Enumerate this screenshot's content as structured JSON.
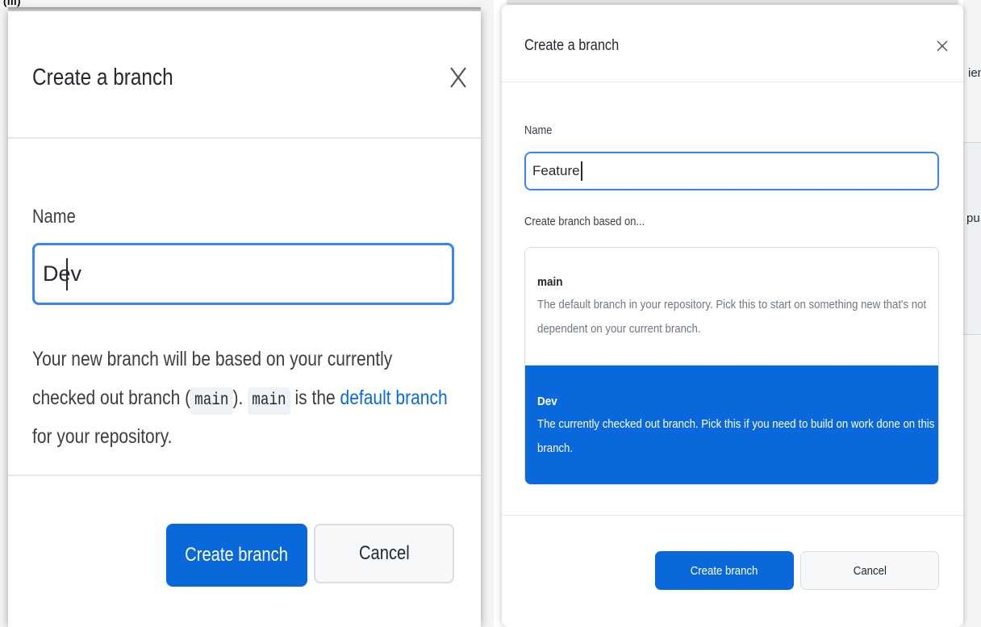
{
  "panel_label": "(iii)",
  "left_dialog": {
    "title": "Create a branch",
    "close_glyph": "X",
    "name_label": "Name",
    "name_value": "Dev",
    "description": {
      "part1": "Your new branch will be based on your currently checked out branch (",
      "code1": "main",
      "part2": ").",
      "code2": "main",
      "part3": " is the ",
      "link": "default branch",
      "part4": " for your repository."
    },
    "create_label": "Create branch",
    "cancel_label": "Cancel"
  },
  "right_dialog": {
    "title": "Create a branch",
    "close_glyph": "×",
    "name_label": "Name",
    "name_value": "Feature",
    "based_on_label": "Create branch based on...",
    "options": [
      {
        "title": "main",
        "description": "The default branch in your repository. Pick this to start on something new that's not dependent on your current branch.",
        "selected": false
      },
      {
        "title": "Dev",
        "description": "The currently checked out branch. Pick this if you need to build on work done on this branch.",
        "selected": true
      }
    ],
    "create_label": "Create branch",
    "cancel_label": "Cancel"
  },
  "background_fragments": [
    "ien",
    "pu"
  ],
  "colors": {
    "accent": "#0969da",
    "focus_border": "#3b82f6",
    "divider": "#e5e7eb"
  },
  "icons": {
    "close": "close-icon"
  }
}
